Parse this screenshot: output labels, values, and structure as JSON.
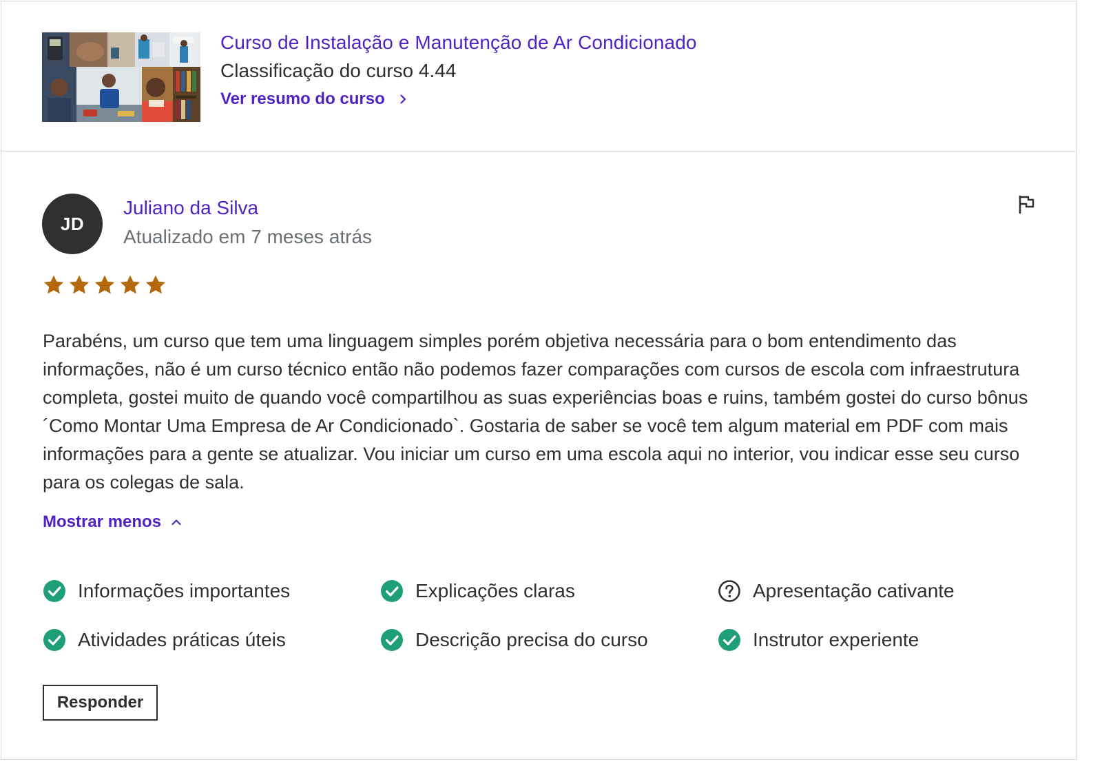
{
  "course": {
    "title": "Curso de Instalação e Manutenção de Ar Condicionado",
    "rating_text": "Classificação do curso 4.44",
    "summary_link": "Ver resumo do curso",
    "summary_link_icon": "chevron-right-icon"
  },
  "review": {
    "avatar_initials": "JD",
    "reviewer_name": "Juliano da Silva",
    "updated": "Atualizado em 7 meses atrás",
    "report_icon": "flag-icon",
    "rating": 5,
    "max_rating": 5,
    "star_color": "#b4690e",
    "text": "Parabéns, um curso que tem uma linguagem simples porém objetiva necessária para o bom entendimento das informações, não é um curso técnico então não podemos fazer comparações com cursos de escola com infraestrutura completa, gostei muito de quando você compartilhou as suas experiências boas e ruins, também gostei do curso bônus ´Como Montar Uma Empresa de Ar Condicionado`. Gostaria de saber se você tem algum material em PDF com mais informações para a gente se atualizar. Vou iniciar um curso em uma escola aqui no interior, vou indicar esse seu curso para os colegas de sala.",
    "show_less": "Mostrar menos",
    "show_less_icon": "chevron-up-icon",
    "attributes": [
      {
        "label": "Informações importantes",
        "icon": "check-circle-icon"
      },
      {
        "label": "Explicações claras",
        "icon": "check-circle-icon"
      },
      {
        "label": "Apresentação cativante",
        "icon": "question-circle-icon"
      },
      {
        "label": "Atividades práticas úteis",
        "icon": "check-circle-icon"
      },
      {
        "label": "Descrição precisa do curso",
        "icon": "check-circle-icon"
      },
      {
        "label": "Instrutor experiente",
        "icon": "check-circle-icon"
      }
    ],
    "reply_button": "Responder"
  },
  "colors": {
    "brand": "#5022c3",
    "text": "#2d2f31",
    "muted": "#6a6f73",
    "success": "#1e9f78",
    "border": "#d1d7dc"
  }
}
